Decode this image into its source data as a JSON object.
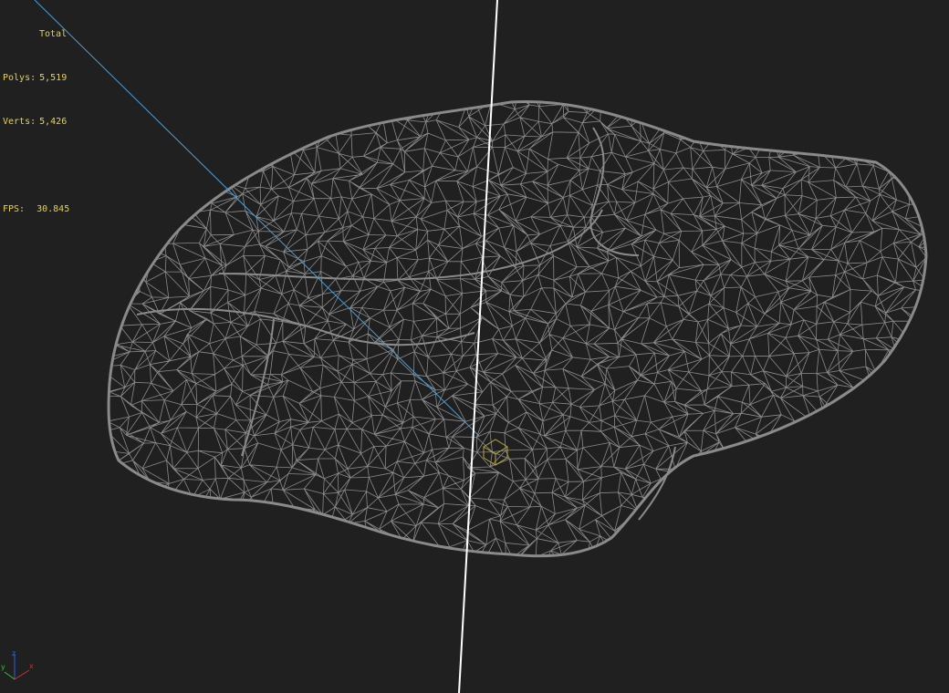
{
  "stats": {
    "title": "Total",
    "polys_label": "Polys:",
    "polys_value": "5,519",
    "verts_label": "Verts:",
    "verts_value": "5,426",
    "fps_label": "FPS:",
    "fps_value": "30.845"
  },
  "colors": {
    "background": "#202020",
    "wireframe": "#8a8a8a",
    "stats_text": "#e8d24a",
    "vertical_axis": "#ffffff",
    "diagonal_axis": "#4a9fd8",
    "pivot_gizmo": "#b8a83a",
    "axis_x": "#d03030",
    "axis_y": "#30c030",
    "axis_z": "#3060e0"
  },
  "axis_tripod": {
    "x_label": "x",
    "y_label": "y",
    "z_label": "z"
  }
}
